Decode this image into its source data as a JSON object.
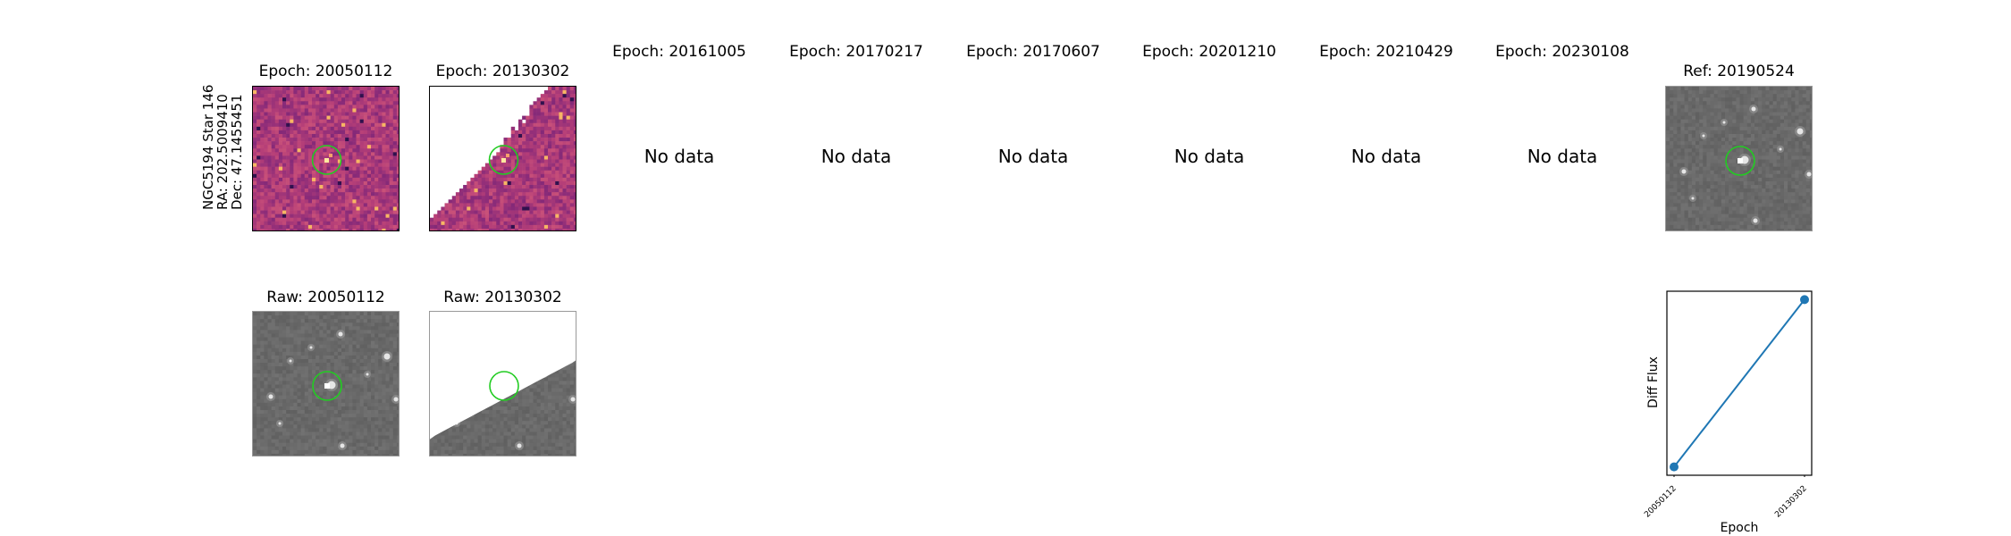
{
  "star_label": {
    "line1": "NGC5194 Star 146",
    "line2": "RA: 202.5009410",
    "line3": "Dec: 47.1455451"
  },
  "epochs_row": [
    {
      "title": "Epoch: 20050112",
      "has_data": true
    },
    {
      "title": "Epoch: 20130302",
      "has_data": true
    },
    {
      "title": "Epoch: 20161005",
      "has_data": false,
      "nodata": "No data"
    },
    {
      "title": "Epoch: 20170217",
      "has_data": false,
      "nodata": "No data"
    },
    {
      "title": "Epoch: 20170607",
      "has_data": false,
      "nodata": "No data"
    },
    {
      "title": "Epoch: 20201210",
      "has_data": false,
      "nodata": "No data"
    },
    {
      "title": "Epoch: 20210429",
      "has_data": false,
      "nodata": "No data"
    },
    {
      "title": "Epoch: 20230108",
      "has_data": false,
      "nodata": "No data"
    }
  ],
  "reference": {
    "title": "Ref: 20190524"
  },
  "raw_row": [
    {
      "title": "Raw: 20050112"
    },
    {
      "title": "Raw: 20130302"
    }
  ],
  "colors": {
    "marker_circle": "#22cc22",
    "series_line": "#1f77b4",
    "diff_colormap": [
      "#2a0f4a",
      "#5c1d6e",
      "#8a2b79",
      "#b63f78",
      "#d8607a",
      "#f08c5c",
      "#fbc868"
    ],
    "raw_background": "#6e6e6e"
  },
  "chart_data": {
    "type": "line",
    "title": "",
    "xlabel": "Epoch",
    "ylabel": "Diff Flux",
    "x": [
      "20050112",
      "20130302"
    ],
    "series": [
      {
        "values": [
          0.0,
          1.0
        ]
      }
    ],
    "ylim": [
      -0.05,
      1.05
    ],
    "yticks_shown": false,
    "grid": false
  }
}
